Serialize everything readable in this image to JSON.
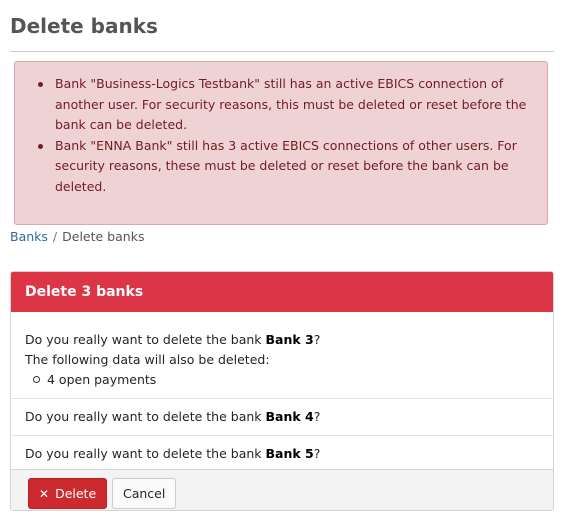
{
  "page": {
    "title": "Delete banks"
  },
  "alert": {
    "items": [
      "Bank \"Business-Logics Testbank\" still has an active EBICS connection of another user. For security reasons, this must be deleted or reset before the bank can be deleted.",
      "Bank \"ENNA Bank\" still has 3 active EBICS connections of other users. For security reasons, these must be deleted or reset before the bank can be deleted."
    ]
  },
  "breadcrumb": {
    "link": "Banks",
    "separator": "/",
    "current": "Delete banks"
  },
  "card": {
    "title": "Delete 3 banks",
    "question_prefix": "Do you really want to delete the bank",
    "question_suffix": "?",
    "rows": [
      {
        "bank": "Bank 3",
        "also_deleted_label": "The following data will also be deleted:",
        "also_deleted_items": [
          "4 open payments"
        ]
      },
      {
        "bank": "Bank 4"
      },
      {
        "bank": "Bank 5"
      }
    ],
    "delete_label": "Delete",
    "cancel_label": "Cancel"
  },
  "colors": {
    "danger": "#dc3545",
    "alert_bg": "#efd2d4",
    "alert_text": "#721c24",
    "link": "#2f6aa3"
  },
  "icons": {
    "delete": "close-icon"
  }
}
